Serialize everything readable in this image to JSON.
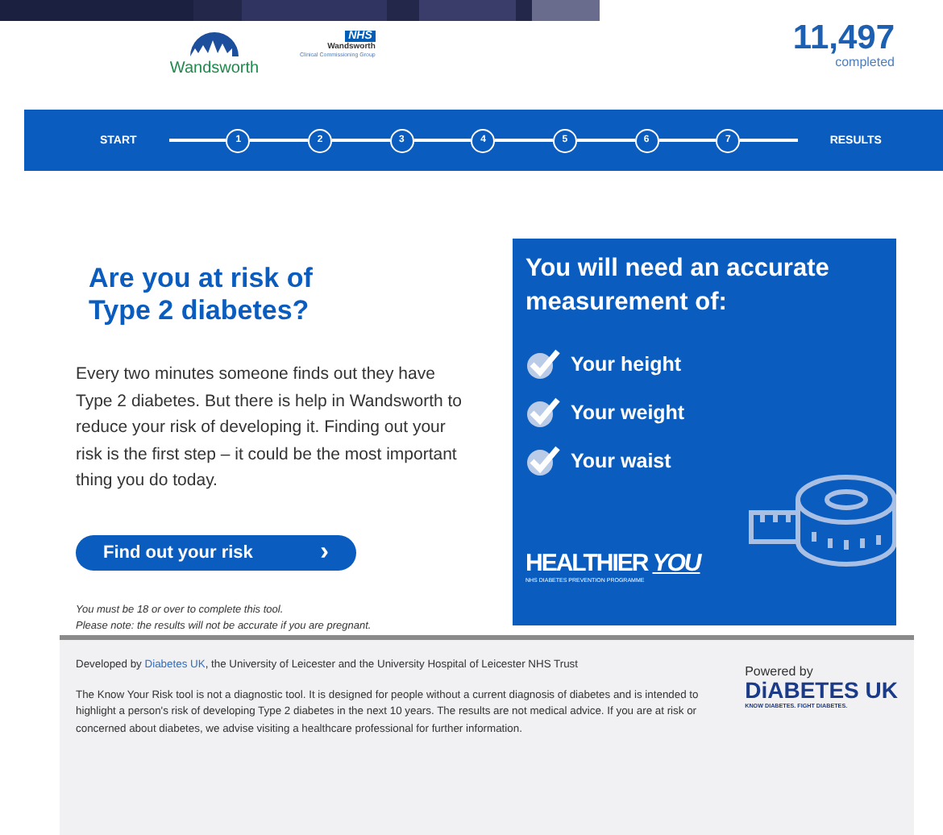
{
  "header": {
    "council_logo": "Wandsworth",
    "nhs_logo": {
      "badge": "NHS",
      "name": "Wandsworth",
      "subtitle": "Clinical Commissioning Group"
    },
    "counter": {
      "value": "11,497",
      "label": "completed"
    }
  },
  "stepper": {
    "start": "START",
    "steps": [
      "1",
      "2",
      "3",
      "4",
      "5",
      "6",
      "7"
    ],
    "end": "RESULTS"
  },
  "intro": {
    "title": "Are you at risk of Type 2 diabetes?",
    "body": "Every two minutes someone finds out they have Type 2 diabetes. But there is help in Wandsworth to reduce your risk of developing it. Finding out your risk is the first step – it could be the most important thing you do today.",
    "button": "Find out your risk",
    "button_icon": "›",
    "notes": [
      "You must be 18 or over to complete this tool.",
      "Please note: the results will not be accurate if you are pregnant."
    ]
  },
  "card": {
    "title": "You will need an accurate measurement of:",
    "items": [
      {
        "label": "Your height",
        "checked": true
      },
      {
        "label": "Your weight",
        "checked": true
      },
      {
        "label": "Your waist",
        "checked": true
      }
    ],
    "brand": {
      "word1": "HEALTHIER",
      "word2": "YOU",
      "tagline": "NHS DIABETES PREVENTION PROGRAMME"
    }
  },
  "footer": {
    "credit_prefix": "Developed by ",
    "credit_link": "Diabetes UK",
    "credit_suffix": ", the University of Leicester and the University Hospital of Leicester NHS Trust",
    "disclaimer": "The Know Your Risk tool is not a diagnostic tool. It is designed for people without a current diagnosis of diabetes and is intended to highlight a person's risk of developing Type 2 diabetes in the next 10 years. The results are not medical advice. If you are at risk or concerned about diabetes, we advise visiting a healthcare professional for further information.",
    "powered_by": "Powered by",
    "logo": "DiABETES UK",
    "logo_tagline": "KNOW DIABETES. FIGHT DIABETES."
  }
}
